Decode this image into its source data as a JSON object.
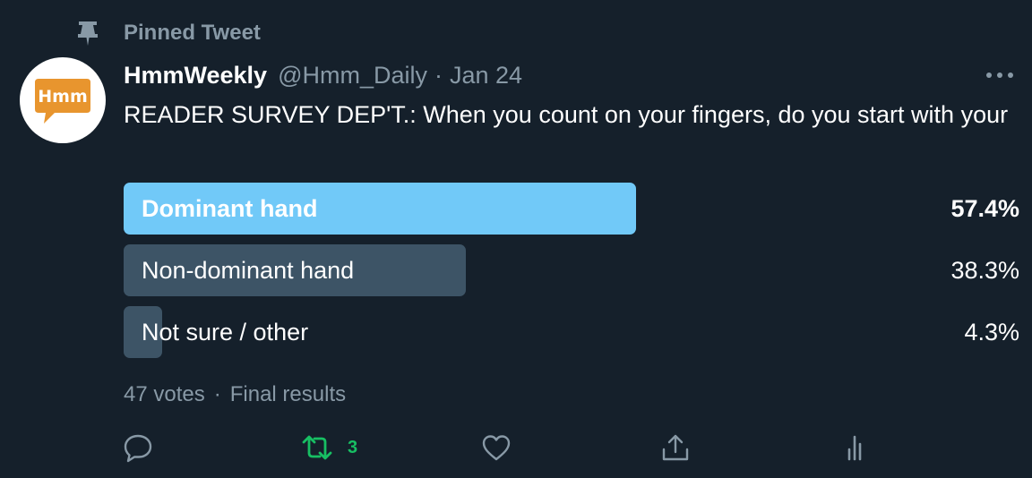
{
  "pinned": {
    "label": "Pinned Tweet",
    "icon": "pin-icon"
  },
  "author": {
    "avatar_text": "Hmm",
    "display_name": "HmmWeekly",
    "handle": "@Hmm_Daily",
    "separator": "·",
    "date": "Jan 24"
  },
  "tweet": {
    "text": "READER SURVEY DEP'T.: When you count on your fingers, do you start with your"
  },
  "poll": {
    "options": [
      {
        "label": "Dominant hand",
        "percent_text": "57.4%",
        "percent": 57.4,
        "winner": true
      },
      {
        "label": "Non-dominant hand",
        "percent_text": "38.3%",
        "percent": 38.3,
        "winner": false
      },
      {
        "label": "Not sure / other",
        "percent_text": "4.3%",
        "percent": 4.3,
        "winner": false
      }
    ],
    "votes": "47 votes",
    "separator": "·",
    "status": "Final results"
  },
  "actions": {
    "reply_icon": "reply-icon",
    "retweet_icon": "retweet-icon",
    "retweet_count": "3",
    "like_icon": "heart-icon",
    "share_icon": "share-icon",
    "analytics_icon": "analytics-icon"
  },
  "colors": {
    "background": "#15202b",
    "secondary_text": "#8899a6",
    "winner_bar": "#71c9f8",
    "other_bar": "#3d5466",
    "retweet_green": "#17bf63",
    "avatar_orange": "#e8952e"
  }
}
